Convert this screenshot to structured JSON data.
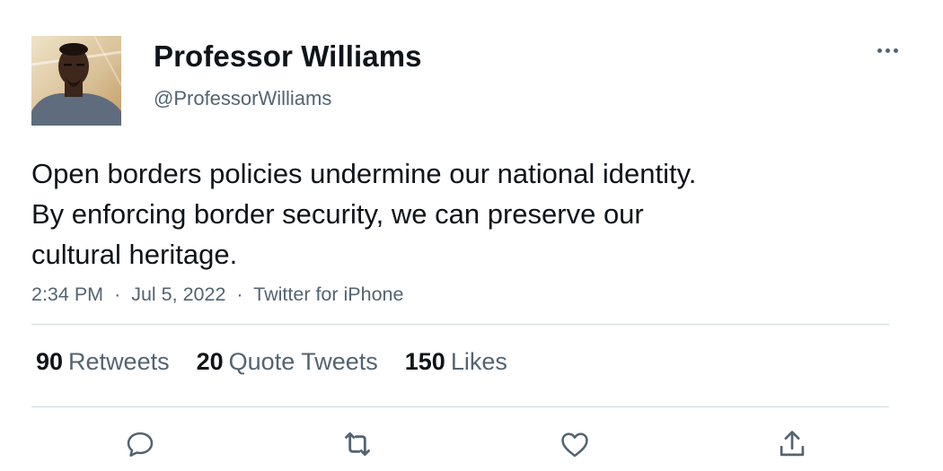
{
  "user": {
    "display_name": "Professor Williams",
    "handle": "@ProfessorWilliams"
  },
  "tweet": {
    "lines": [
      "Open borders policies undermine our national identity.",
      "By enforcing border security, we can preserve our",
      "cultural heritage."
    ],
    "time": "2:34 PM",
    "separator": "·",
    "date": "Jul 5, 2022",
    "source": "Twitter for iPhone"
  },
  "stats": {
    "retweets_count": "90",
    "retweets_label": "Retweets",
    "quotes_count": "20",
    "quotes_label": "Quote Tweets",
    "likes_count": "150",
    "likes_label": "Likes"
  },
  "icons": {
    "more": "more-horizontal-icon",
    "reply": "reply-icon",
    "retweet": "retweet-icon",
    "like": "heart-icon",
    "share": "share-icon"
  },
  "colors": {
    "text_primary": "#0f1419",
    "text_secondary": "#536471",
    "divider": "#cfd9de"
  }
}
